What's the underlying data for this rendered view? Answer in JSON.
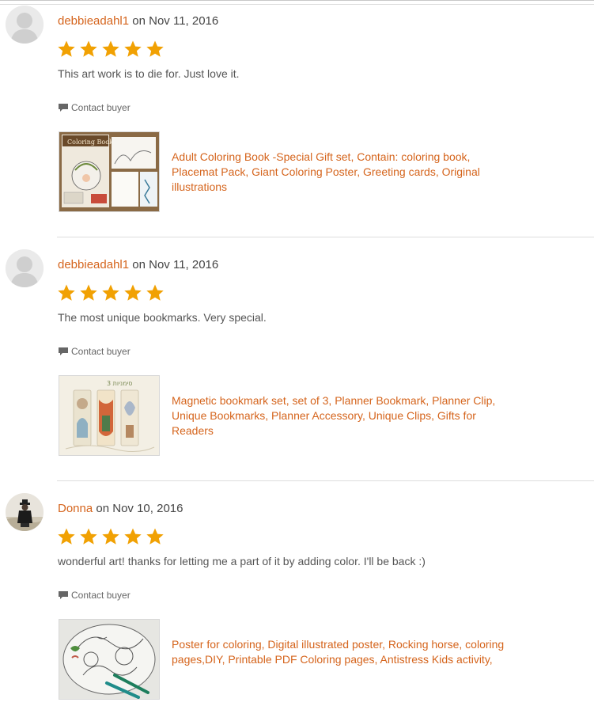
{
  "reviews": [
    {
      "buyer": "debbieadahl1",
      "date_prefix": " on ",
      "date": "Nov 11, 2016",
      "rating": 5,
      "text": "This art work is to die for. Just love it.",
      "contact_label": "Contact buyer",
      "listing_title": "Adult Coloring Book -Special Gift set, Contain: coloring book, Placemat Pack, Giant Coloring Poster, Greeting cards, Original illustrations",
      "thumb_label": "Coloring Books"
    },
    {
      "buyer": "debbieadahl1",
      "date_prefix": " on ",
      "date": "Nov 11, 2016",
      "rating": 5,
      "text": "The most unique bookmarks. Very special.",
      "contact_label": "Contact buyer",
      "listing_title": "Magnetic bookmark set, set of 3, Planner Bookmark, Planner Clip, Unique Bookmarks, Planner Accessory, Unique Clips, Gifts for Readers",
      "thumb_label": "3 סימניות"
    },
    {
      "buyer": "Donna",
      "date_prefix": " on ",
      "date": "Nov 10, 2016",
      "rating": 5,
      "text": "wonderful art! thanks for letting me a part of it by adding color. I'll be back :)",
      "contact_label": "Contact buyer",
      "listing_title": "Poster for coloring, Digital illustrated poster, Rocking horse, coloring pages,DIY, Printable PDF Coloring pages, Antistress Kids activity,",
      "thumb_label": ""
    }
  ],
  "colors": {
    "link": "#d5641c",
    "star": "#f1a103",
    "text": "#555555",
    "divider": "#dddddd"
  },
  "icons": {
    "star": "star-icon",
    "contact": "speech-bubble-icon",
    "avatar_default": "default-avatar-icon"
  }
}
